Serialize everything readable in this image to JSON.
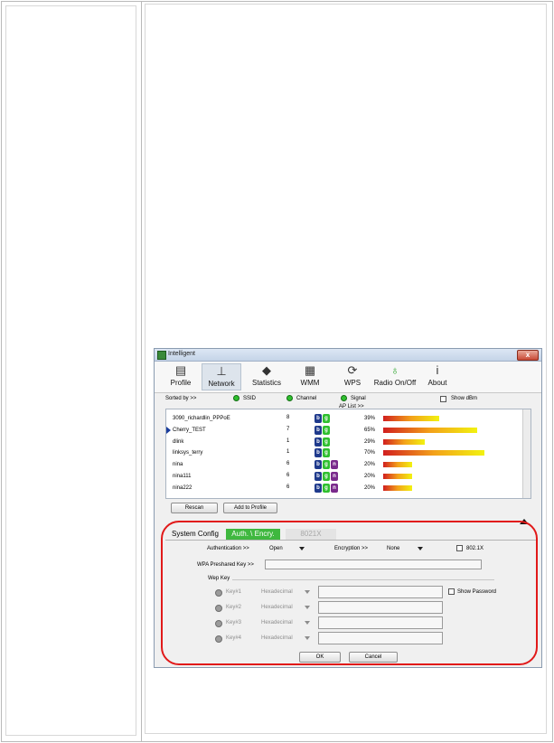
{
  "window": {
    "title": "Intelligent",
    "close": "x"
  },
  "toolbar": [
    {
      "label": "Profile",
      "icon": "profile-icon",
      "glyph": "▤"
    },
    {
      "label": "Network",
      "icon": "network-icon",
      "glyph": "⊥"
    },
    {
      "label": "Statistics",
      "icon": "statistics-icon",
      "glyph": "◆"
    },
    {
      "label": "WMM",
      "icon": "wmm-icon",
      "glyph": "▦"
    },
    {
      "label": "WPS",
      "icon": "wps-icon",
      "glyph": "⟳"
    },
    {
      "label": "Radio On/Off",
      "icon": "radio-icon",
      "glyph": "♁"
    },
    {
      "label": "About",
      "icon": "about-icon",
      "glyph": "i"
    }
  ],
  "sort": {
    "sorted_by": "Sorted by >>",
    "ssid": "SSID",
    "channel": "Channel",
    "signal": "Signal",
    "show_dbm": "Show dBm"
  },
  "ap_list": {
    "title": "AP List >>",
    "rows": [
      {
        "ssid": "3090_richardlin_PPPoE",
        "channel": "8",
        "modes": [
          "b",
          "g"
        ],
        "pct": "39%",
        "signal": 39,
        "selected": false
      },
      {
        "ssid": "Cherry_TEST",
        "channel": "7",
        "modes": [
          "b",
          "g"
        ],
        "pct": "65%",
        "signal": 65,
        "selected": true
      },
      {
        "ssid": "dlink",
        "channel": "1",
        "modes": [
          "b",
          "g"
        ],
        "pct": "29%",
        "signal": 29,
        "selected": false
      },
      {
        "ssid": "linksys_terry",
        "channel": "1",
        "modes": [
          "b",
          "g"
        ],
        "pct": "70%",
        "signal": 70,
        "selected": false
      },
      {
        "ssid": "nina",
        "channel": "6",
        "modes": [
          "b",
          "g",
          "n"
        ],
        "pct": "20%",
        "signal": 20,
        "selected": false
      },
      {
        "ssid": "nina111",
        "channel": "6",
        "modes": [
          "b",
          "g",
          "n"
        ],
        "pct": "20%",
        "signal": 20,
        "selected": false
      },
      {
        "ssid": "nina222",
        "channel": "6",
        "modes": [
          "b",
          "g",
          "n"
        ],
        "pct": "20%",
        "signal": 20,
        "selected": false
      }
    ]
  },
  "buttons": {
    "rescan": "Rescan",
    "add_profile": "Add to Profile",
    "ok": "OK",
    "cancel": "Cancel"
  },
  "tabs": [
    {
      "label": "System Config",
      "state": "normal"
    },
    {
      "label": "Auth. \\ Encry.",
      "state": "selected"
    },
    {
      "label": "8021X",
      "state": "disabled"
    }
  ],
  "auth": {
    "authentication_label": "Authentication >>",
    "authentication_value": "Open",
    "encryption_label": "Encryption >>",
    "encryption_value": "None",
    "ieee_label": "802.1X",
    "wpa_label": "WPA Preshared Key >>",
    "wep_label": "Wep Key",
    "show_password": "Show Password",
    "keys": [
      {
        "label": "Key#1",
        "type": "Hexadecimal"
      },
      {
        "label": "Key#2",
        "type": "Hexadecimal"
      },
      {
        "label": "Key#3",
        "type": "Hexadecimal"
      },
      {
        "label": "Key#4",
        "type": "Hexadecimal"
      }
    ]
  },
  "colors": {
    "accent_green": "#3fb83f",
    "highlight_red": "#e11919",
    "mode_b": "#1f3a8c",
    "mode_g": "#2fbf2f",
    "mode_n": "#7a2a8c"
  }
}
